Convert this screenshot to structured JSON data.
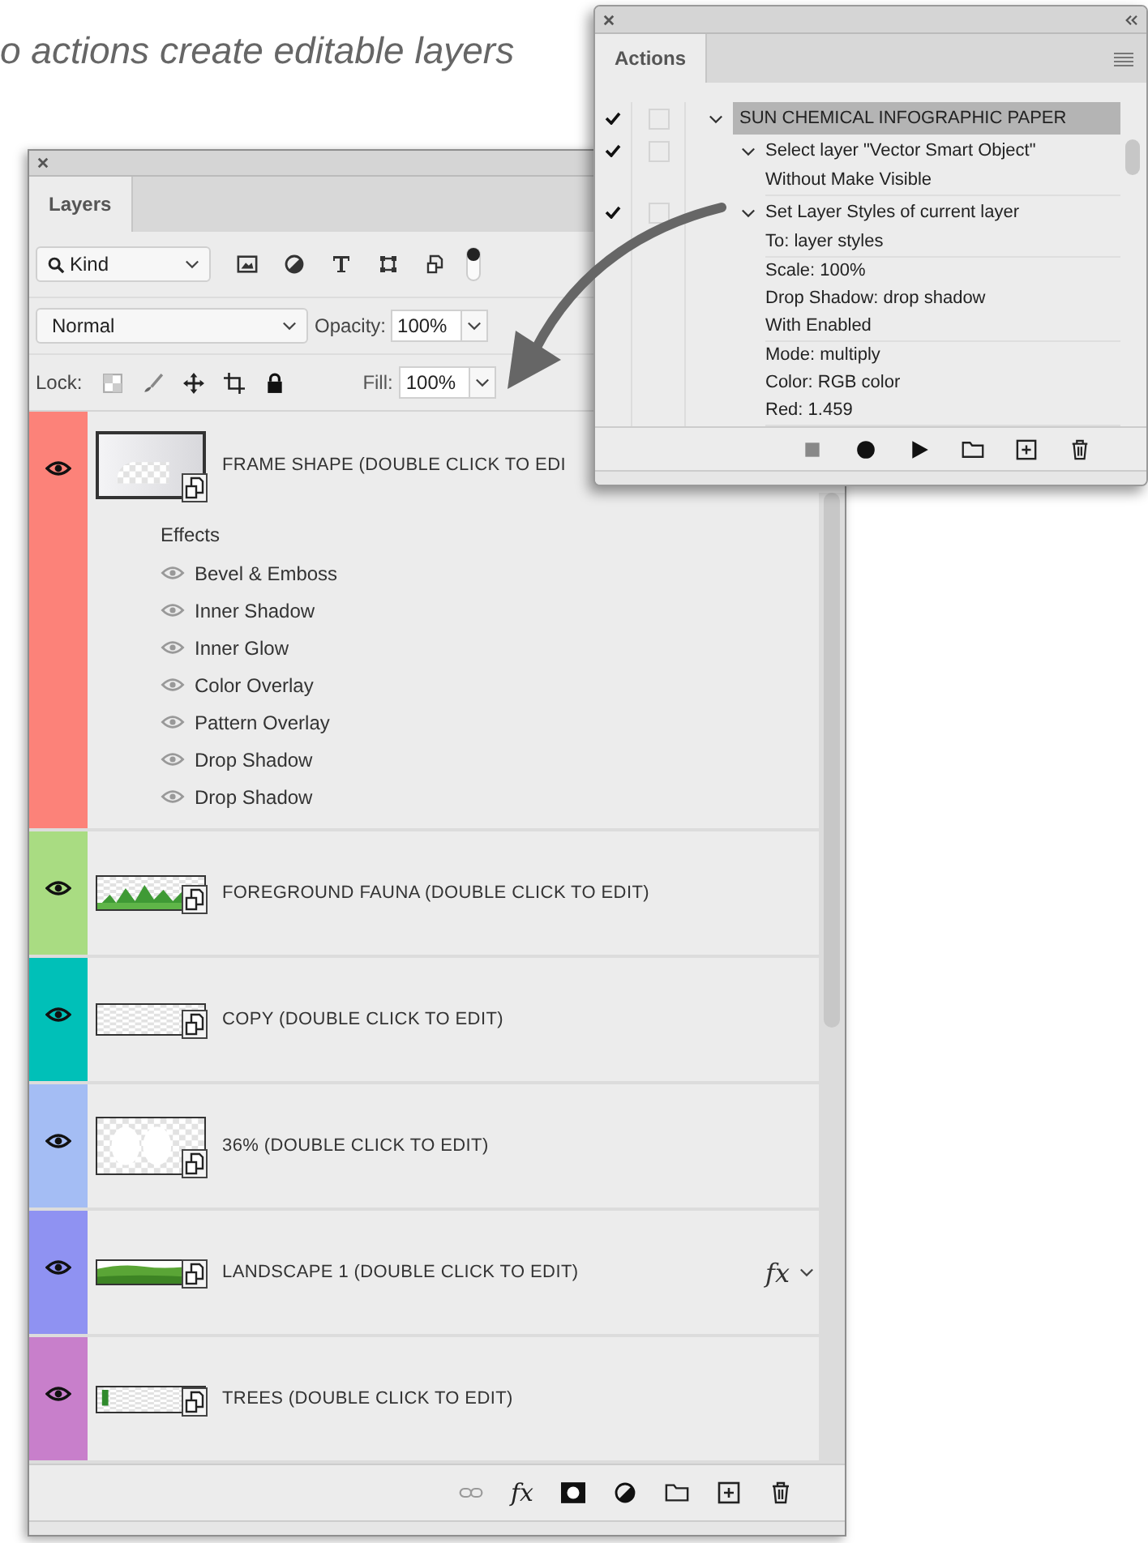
{
  "caption": "o actions create editable layers",
  "layers_panel": {
    "tab": {
      "label": "Layers",
      "selected": true
    },
    "filter": {
      "value": "Kind"
    },
    "blend_mode": "Normal",
    "opacity_label": "Opacity:",
    "opacity": "100%",
    "lock_label": "Lock:",
    "fill_label": "Fill:",
    "fill": "100%",
    "layers": [
      {
        "name": "FRAME SHAPE (DOUBLE CLICK TO EDI",
        "color": "#fc8279",
        "visible": true,
        "effects_label": "Effects",
        "effects": [
          {
            "name": "Bevel & Emboss",
            "visible": true
          },
          {
            "name": "Inner Shadow",
            "visible": true
          },
          {
            "name": "Inner Glow",
            "visible": true
          },
          {
            "name": "Color Overlay",
            "visible": true
          },
          {
            "name": "Pattern Overlay",
            "visible": true
          },
          {
            "name": "Drop Shadow",
            "visible": true
          },
          {
            "name": "Drop Shadow",
            "visible": true
          }
        ]
      },
      {
        "name": "FOREGROUND FAUNA (DOUBLE CLICK TO EDIT)",
        "color": "#a9dc82",
        "visible": true
      },
      {
        "name": "COPY (DOUBLE CLICK TO EDIT)",
        "color": "#00c0b8",
        "visible": true
      },
      {
        "name": "36% (DOUBLE CLICK TO EDIT)",
        "color": "#a4bdf4",
        "visible": true
      },
      {
        "name": "LANDSCAPE 1 (DOUBLE CLICK TO EDIT)",
        "color": "#8f92f2",
        "visible": true,
        "fx": "fx"
      },
      {
        "name": "TREES (DOUBLE CLICK TO EDIT)",
        "color": "#c87fcb",
        "visible": true
      }
    ],
    "footer_buttons": [
      {
        "kind": "link"
      },
      {
        "kind": "fx",
        "label": "fx"
      },
      {
        "kind": "mask"
      },
      {
        "kind": "adjust"
      },
      {
        "kind": "folder"
      },
      {
        "kind": "new"
      },
      {
        "kind": "trash"
      }
    ]
  },
  "actions_panel": {
    "tab": {
      "label": "Actions",
      "selected": true
    },
    "actions": [
      {
        "name": "SUN CHEMICAL INFOGRAPHIC PAPER",
        "checked": true,
        "dialog": false,
        "expanded": true,
        "selected": true,
        "children": [
          {
            "name": "Select layer \"Vector Smart Object\"",
            "checked": true,
            "dialog": false,
            "expanded": true,
            "detail_groups": [
              [
                "Without Make Visible"
              ]
            ]
          },
          {
            "name": "Set Layer Styles of current layer",
            "checked": true,
            "dialog": false,
            "expanded": true,
            "detail_groups": [
              [
                "To: layer styles"
              ],
              [
                "Scale: 100%",
                "Drop Shadow: drop shadow",
                "With Enabled"
              ],
              [
                "Mode: multiply",
                "Color: RGB color",
                "Red: 1.459"
              ]
            ]
          }
        ]
      }
    ],
    "footer_buttons": [
      {
        "kind": "stop"
      },
      {
        "kind": "record"
      },
      {
        "kind": "play"
      },
      {
        "kind": "folder"
      },
      {
        "kind": "new"
      },
      {
        "kind": "trash"
      }
    ]
  }
}
